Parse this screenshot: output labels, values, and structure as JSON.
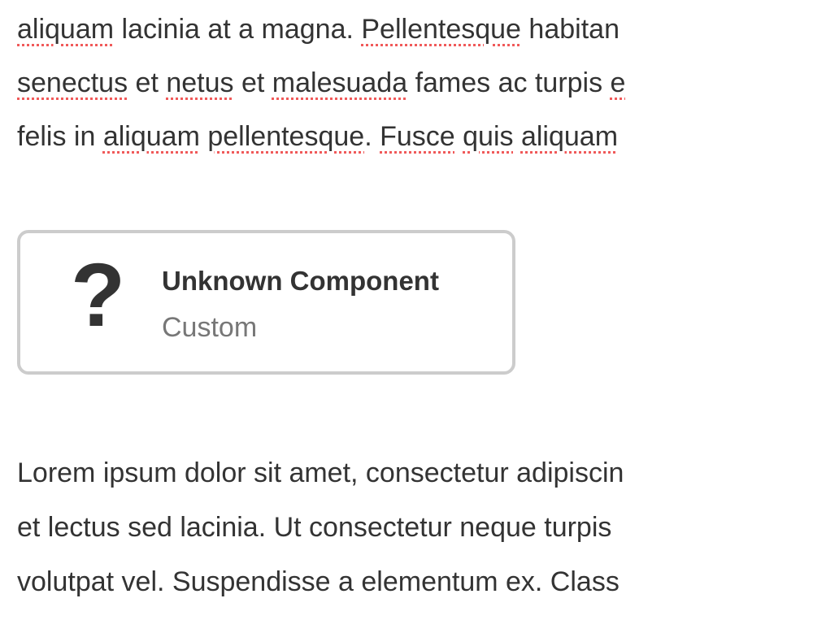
{
  "paragraph_top": [
    [
      {
        "text": "aliquam",
        "misspelled": true
      },
      {
        "text": " lacinia at a magna. ",
        "misspelled": false
      },
      {
        "text": "Pellentesque",
        "misspelled": true
      },
      {
        "text": " habitan",
        "misspelled": false
      }
    ],
    [
      {
        "text": "senectus",
        "misspelled": true
      },
      {
        "text": " et ",
        "misspelled": false
      },
      {
        "text": "netus",
        "misspelled": true
      },
      {
        "text": " et ",
        "misspelled": false
      },
      {
        "text": "malesuada",
        "misspelled": true
      },
      {
        "text": " fames ac turpis ",
        "misspelled": false
      },
      {
        "text": "e",
        "misspelled": true
      }
    ],
    [
      {
        "text": "felis in ",
        "misspelled": false
      },
      {
        "text": "aliquam",
        "misspelled": true
      },
      {
        "text": " ",
        "misspelled": false
      },
      {
        "text": "pellentesque",
        "misspelled": true
      },
      {
        "text": ". ",
        "misspelled": false
      },
      {
        "text": "Fusce",
        "misspelled": true
      },
      {
        "text": " ",
        "misspelled": false
      },
      {
        "text": "quis",
        "misspelled": true
      },
      {
        "text": " ",
        "misspelled": false
      },
      {
        "text": "aliquam",
        "misspelled": true
      }
    ]
  ],
  "component_card": {
    "icon": "question-mark-icon",
    "icon_glyph": "?",
    "title": "Unknown Component",
    "subtitle": "Custom"
  },
  "paragraph_bottom": [
    "Lorem ipsum dolor sit amet, consectetur adipiscin",
    "et lectus sed lacinia. Ut consectetur neque turpis",
    "volutpat vel. Suspendisse a elementum ex. Class"
  ],
  "colors": {
    "spellcheck_underline": "#f05a5a",
    "text": "#333333",
    "card_border": "#cccccc",
    "subtitle": "#777777"
  }
}
